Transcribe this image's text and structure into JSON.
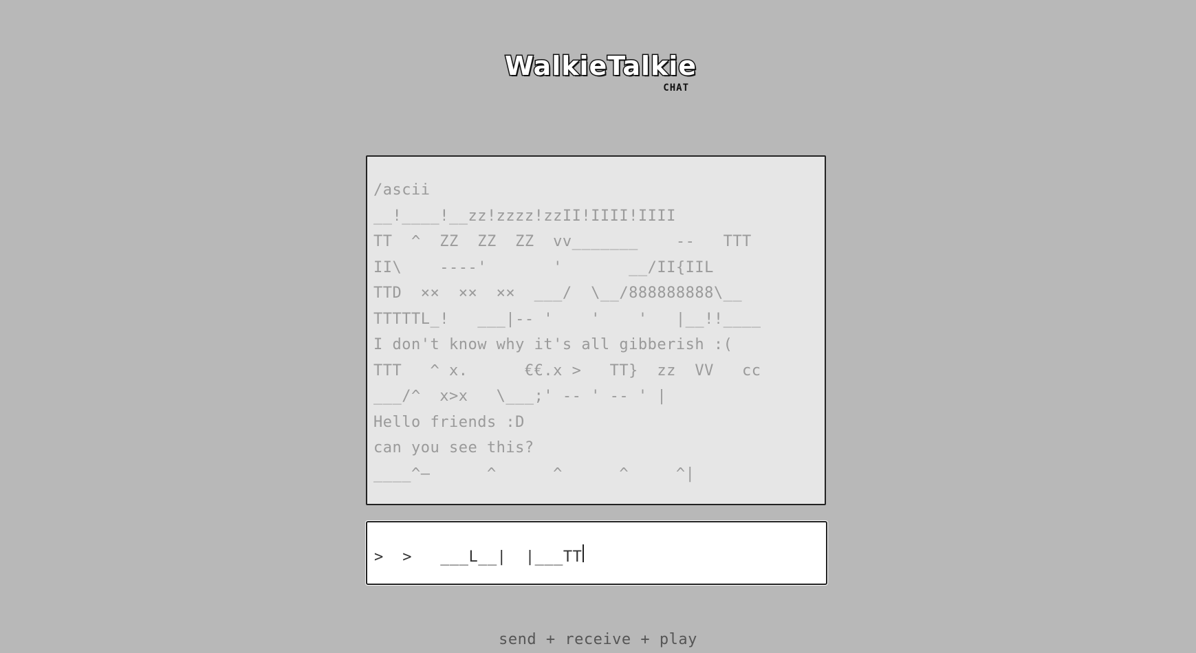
{
  "app": {
    "logo_main": "WalkieTalkie",
    "logo_sub": "CHAT"
  },
  "chat": {
    "lines": [
      "/ascii",
      "__!____!__zz!zzzz!zzII!IIII!IIII",
      "TT  ^  ZZ  ZZ  ZZ  vv_______    --   TTT",
      "II\\    ----'       '       __/II{IIL",
      "TTD  ××  ××  ××  ___/  \\__/888888888\\__",
      "TTTTTL_!   ___|-- '    '    '   |__!!____",
      "I don't know why it's all gibberish :(",
      "TTT   ^ x.      €€.x >   TT}  zz  VV   cc",
      "___/^  x>x   \\___;' -- ' -- ' |",
      "Hello friends :D",
      "can you see this?",
      "____^–      ^      ^      ^     ^|"
    ]
  },
  "input": {
    "value": ">  >   ___L__|  |___TT"
  },
  "footer": {
    "tagline": "send + receive + play"
  }
}
